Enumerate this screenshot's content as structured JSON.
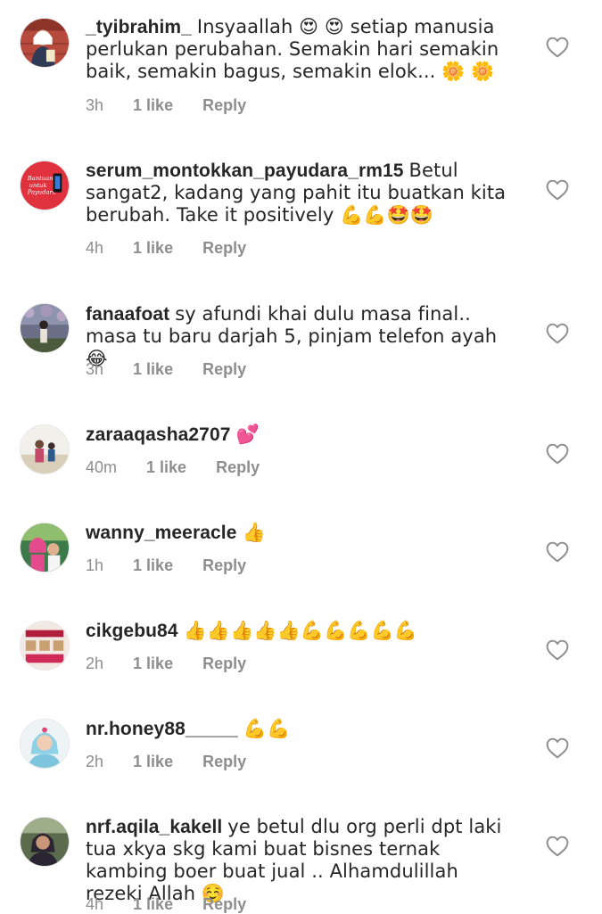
{
  "comments": [
    {
      "username": "_tyibrahim_",
      "text": "Insyaallah 😍 😍 setiap manusia perlukan perubahan. Semakin hari semakin baik, semakin bagus, semakin elok... 🌼 🌼",
      "time": "3h",
      "likes": "1 like",
      "reply": "Reply"
    },
    {
      "username": "serum_montokkan_payudara_rm15",
      "text": "Betul sangat2, kadang yang pahit itu buatkan kita berubah. Take it positively 💪💪🤩🤩",
      "time": "4h",
      "likes": "1 like",
      "reply": "Reply"
    },
    {
      "username": "fanaafoat",
      "text": "sy afundi khai dulu masa final.. masa tu baru darjah 5, pinjam telefon ayah 😂",
      "time": "3h",
      "likes": "1 like",
      "reply": "Reply"
    },
    {
      "username": "zaraaqasha2707",
      "text": "💕",
      "time": "40m",
      "likes": "1 like",
      "reply": "Reply"
    },
    {
      "username": "wanny_meeracle",
      "text": "👍",
      "time": "1h",
      "likes": "1 like",
      "reply": "Reply"
    },
    {
      "username": "cikgebu84",
      "text": "👍👍👍👍👍💪💪💪💪💪",
      "time": "2h",
      "likes": "1 like",
      "reply": "Reply"
    },
    {
      "username": "nr.honey88_____",
      "text": "💪💪",
      "time": "2h",
      "likes": "1 like",
      "reply": "Reply"
    },
    {
      "username": "nrf.aqila_kakell",
      "text": "ye betul dlu org perli dpt laki tua xkya skg kami buat bisnes ternak kambing boer buat jual .. Alhamdulillah rezeki Allah ☺️",
      "time": "4h",
      "likes": "1 like",
      "reply": "Reply"
    }
  ],
  "icons": {
    "like": "heart-outline-icon"
  },
  "colors": {
    "text": "#262626",
    "meta": "#8e8e8e"
  }
}
